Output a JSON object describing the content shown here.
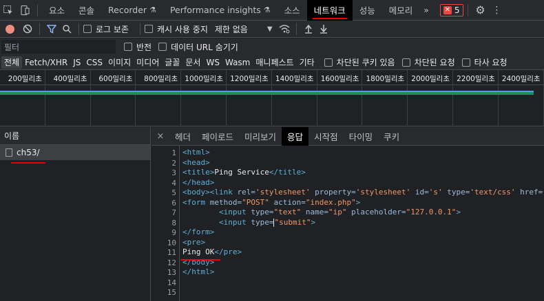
{
  "tabbar": {
    "tabs": [
      {
        "label": "요소",
        "active": false,
        "flask": false
      },
      {
        "label": "콘솔",
        "active": false,
        "flask": false
      },
      {
        "label": "Recorder",
        "active": false,
        "flask": true
      },
      {
        "label": "Performance insights",
        "active": false,
        "flask": true
      },
      {
        "label": "소스",
        "active": false,
        "flask": false
      },
      {
        "label": "네트워크",
        "active": true,
        "flask": false
      },
      {
        "label": "성능",
        "active": false,
        "flask": false
      },
      {
        "label": "메모리",
        "active": false,
        "flask": false
      }
    ],
    "more": "»",
    "error_count": "5"
  },
  "toolbar": {
    "preserve_log": "로그 보존",
    "disable_cache": "캐시 사용 중지",
    "throttle": "제한 없음"
  },
  "filter": {
    "placeholder": "필터",
    "invert": "반전",
    "hide_data_urls": "데이터 URL 숨기기"
  },
  "type_filters": {
    "items": [
      "전체",
      "Fetch/XHR",
      "JS",
      "CSS",
      "이미지",
      "미디어",
      "글꼴",
      "문서",
      "WS",
      "Wasm",
      "매니페스트",
      "기타"
    ],
    "blocked_cookies": "차단된 쿠키 있음",
    "blocked_requests": "차단된 요청",
    "third_party": "타사 요청"
  },
  "timeline": {
    "ticks": [
      "200밀리초",
      "400밀리초",
      "600밀리초",
      "800밀리초",
      "1000밀리초",
      "1200밀리초",
      "1400밀리초",
      "1600밀리초",
      "1800밀리초",
      "2000밀리초",
      "2200밀리초",
      "2400밀리초"
    ]
  },
  "names": {
    "header": "이름",
    "request": "ch53/"
  },
  "response_tabs": {
    "close": "×",
    "tabs": [
      "헤더",
      "페이로드",
      "미리보기",
      "응답",
      "시작점",
      "타이밍",
      "쿠키"
    ],
    "active": "응답"
  },
  "code": {
    "line_numbers": [
      "1",
      "2",
      "3",
      "4",
      "5",
      "6",
      "7",
      "8",
      "9",
      "10",
      "11",
      "12",
      "13",
      "14",
      "15"
    ],
    "lines": [
      "<html>",
      "<head>",
      "<title>Ping Service</title>",
      "</head>",
      "<body><link rel='stylesheet' property='stylesheet' id='s' type='text/css' href='/template/s.css' media='all' />",
      "<form method=\"POST\" action=\"index.php\">",
      "        <input type=\"text\" name=\"ip\" placeholder=\"127.0.0.1\">",
      "        <input type=\"submit\">",
      "</form>",
      "<pre>",
      "Ping OK</pre>",
      "</body>",
      "</html>",
      "",
      ""
    ]
  },
  "colors": {
    "accent_red": "#ee0000",
    "tag": "#5db0d7",
    "string": "#f29766",
    "bar_green": "#1e8e5e",
    "bar_blue": "#4f9de8"
  }
}
